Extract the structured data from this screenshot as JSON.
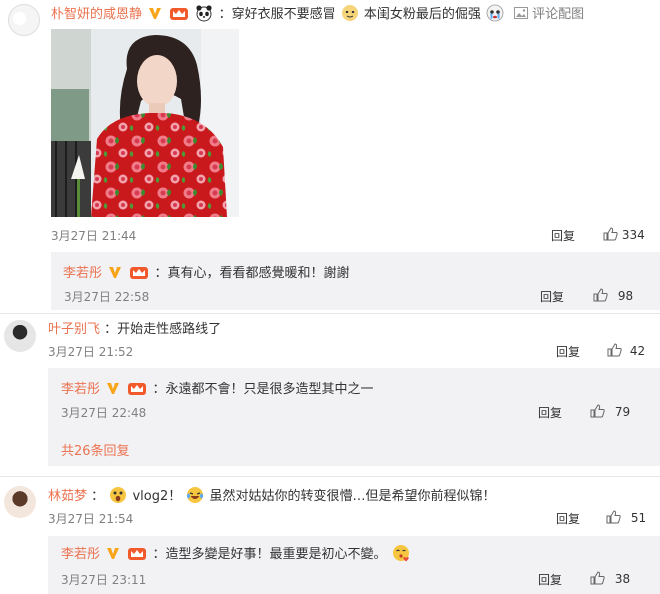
{
  "comments": [
    {
      "user": "朴智妍的咸恩静",
      "text_part1": "：穿好衣服不要感冒",
      "text_part2": "本闺女粉最后的倔强",
      "pic_label": "评论配图",
      "time": "3月27日 21:44",
      "reply_label": "回复",
      "likes": "334"
    },
    {
      "user": "叶子别飞",
      "text": "：开始走性感路线了",
      "time": "3月27日 21:52",
      "reply_label": "回复",
      "likes": "42",
      "more_replies": "共26条回复"
    },
    {
      "user": "林茹梦",
      "text_part1": "：",
      "text_part2": "vlog2！",
      "text_part3": "虽然对姑姑你的转变很懵…但是希望你前程似锦！",
      "time": "3月27日 21:54",
      "reply_label": "回复",
      "likes": "51"
    }
  ],
  "replies": [
    {
      "user": "李若彤",
      "text": "：真有心，看看都感覺暖和！謝謝",
      "time": "3月27日 22:58",
      "reply_label": "回复",
      "likes": "98"
    },
    {
      "user": "李若彤",
      "text": "：永遠都不會！只是很多造型其中之一",
      "time": "3月27日 22:48",
      "reply_label": "回复",
      "likes": "79"
    },
    {
      "user": "李若彤",
      "text": "：造型多變是好事！最重要是初心不變。",
      "time": "3月27日 23:11",
      "reply_label": "回复",
      "likes": "38"
    }
  ],
  "colors": {
    "username": "#eb7350",
    "subbox_bg": "#f2f2f5",
    "vip_badge": "#f8a51c"
  }
}
